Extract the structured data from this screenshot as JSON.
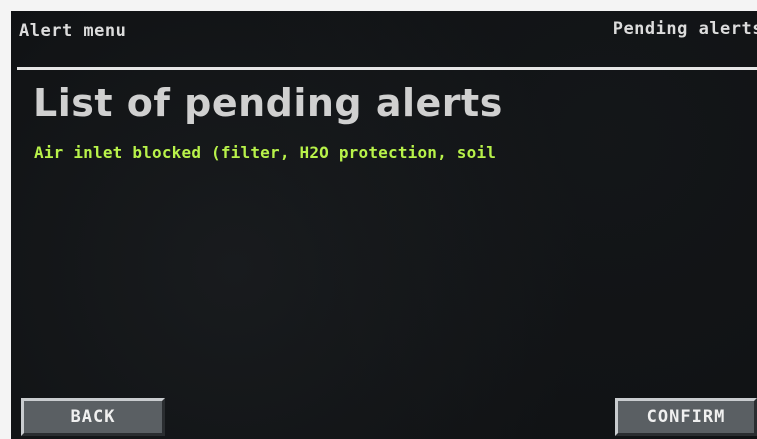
{
  "header": {
    "left_title": "Alert menu",
    "right_title": "Pending alerts"
  },
  "main": {
    "title": "List of pending alerts",
    "alerts": [
      "Air inlet blocked (filter, H2O protection, soil"
    ]
  },
  "buttons": {
    "back_label": "BACK",
    "confirm_label": "CONFIRM"
  },
  "colors": {
    "background": "#101214",
    "alert_text": "#b8f24a",
    "heading_text": "#d0d0d0",
    "button_face": "#5a5f63"
  }
}
